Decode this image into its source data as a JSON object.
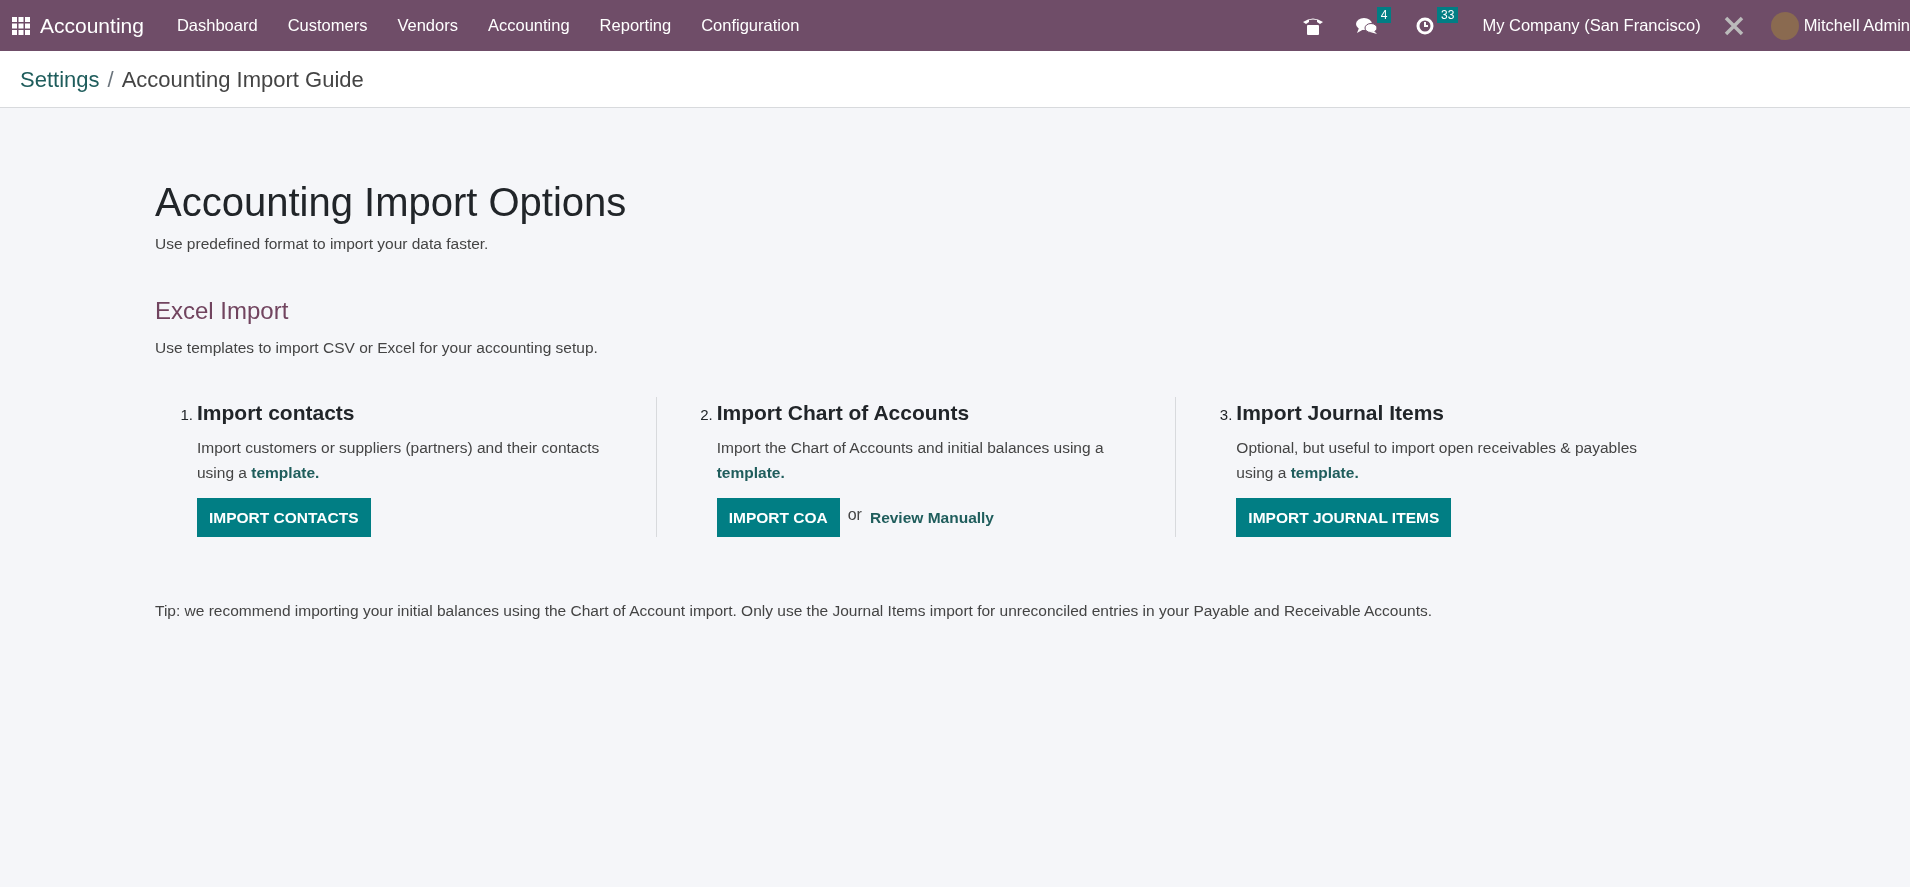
{
  "navbar": {
    "app_name": "Accounting",
    "menu": [
      "Dashboard",
      "Customers",
      "Vendors",
      "Accounting",
      "Reporting",
      "Configuration"
    ],
    "messages_count": "4",
    "activities_count": "33",
    "company": "My Company (San Francisco)",
    "user": "Mitchell Admin"
  },
  "breadcrumb_separator": "/",
  "breadcrumb": [
    {
      "label": "Settings",
      "kind": "link"
    },
    {
      "label": "Accounting Import Guide",
      "kind": "current"
    }
  ],
  "title": "Accounting Import Options",
  "subtitle": "Use predefined format to import your data faster.",
  "section": {
    "title": "Excel Import",
    "description": "Use templates to import CSV or Excel for your accounting setup."
  },
  "steps": [
    {
      "number": "1.",
      "title": "Import contacts",
      "description": "Import customers or suppliers (partners) and their contacts using a",
      "link": "template.",
      "button": "IMPORT CONTACTS"
    },
    {
      "number": "2.",
      "title": "Import Chart of Accounts",
      "description": "Import the Chart of Accounts and initial balances using a",
      "link": "template.",
      "button": "IMPORT COA",
      "separator": "or",
      "alt_link": "Review Manually"
    },
    {
      "number": "3.",
      "title": "Import Journal Items",
      "description": "Optional, but useful to import open receivables & payables using a",
      "link": "template.",
      "button": "IMPORT JOURNAL ITEMS"
    }
  ],
  "tip": "Tip: we recommend importing your initial balances using the Chart of Account import. Only use the Journal Items import for unreconciled entries in your Payable and Receivable Accounts."
}
